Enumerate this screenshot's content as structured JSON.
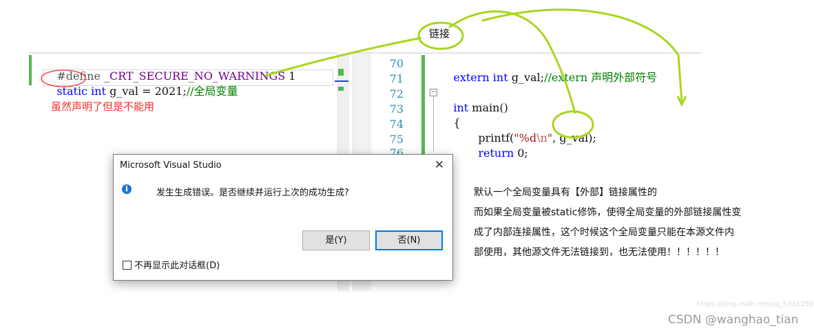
{
  "left_editor": {
    "line1": {
      "directive": "#define",
      "macro": "_CRT_SECURE_NO_WARNINGS",
      "value": "1"
    },
    "line2": {
      "storage": "static",
      "type": "int",
      "rest": "g_val = 2021;",
      "comment": "//全局变量"
    }
  },
  "annotations": {
    "red_note": "虽然声明了但是不能用",
    "link_label": "链接"
  },
  "right_editor": {
    "line_numbers": [
      "70",
      "71",
      "72",
      "73",
      "74",
      "75",
      "76"
    ],
    "line70": {
      "kw": "extern",
      "type": "int",
      "rest": "g_val;",
      "comment": "//extern 声明外部符号"
    },
    "line72": {
      "type": "int",
      "rest": "main()"
    },
    "line73": {
      "rest": "{"
    },
    "line74": {
      "fn": "printf(",
      "str_a": "\"%d",
      "esc": "\\n",
      "str_b": "\"",
      "rest": ", g_val);"
    },
    "line75": {
      "kw": "return",
      "rest": "0;"
    },
    "line76": {
      "rest": "}"
    }
  },
  "dialog": {
    "title": "Microsoft Visual Studio",
    "close_glyph": "✕",
    "message": "发生生成错误。是否继续并运行上次的成功生成?",
    "yes_label": "是(Y)",
    "no_label": "否(N)",
    "dont_show_label": "不再显示此对话框(D)",
    "info_glyph": "i"
  },
  "explanation": {
    "lines": [
      "默认一个全局变量具有【外部】链接属性的",
      "而如果全局变量被static修饰，使得全局变量的外部链接属性变",
      "成了内部连接属性，这个时候这个全局变量只能在本源文件内",
      "部使用，其他源文件无法链接到，也无法使用！！！！！！"
    ]
  },
  "watermark": "https://blog.csdn.net/qq_5336259",
  "csdn_credit": "CSDN @wanghao_tian",
  "colors": {
    "annotation_green": "#a8d61e",
    "annotation_red": "#ff2a2a",
    "keyword": "#0000ff",
    "comment": "#008000",
    "line_number": "#2b91af",
    "gutter_green": "#5ab552",
    "dialog_primary_border": "#0078d7"
  },
  "icons": [
    "info-icon",
    "close-icon",
    "fold-collapse-icon"
  ]
}
